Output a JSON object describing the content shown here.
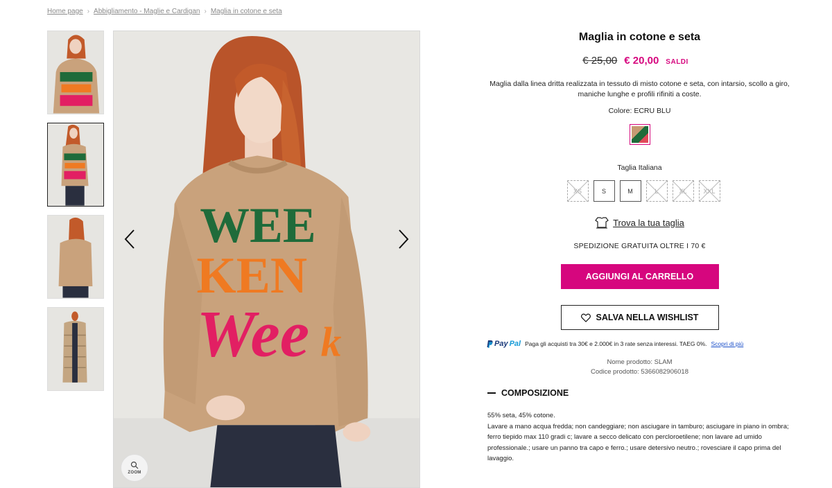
{
  "breadcrumb": {
    "items": [
      "Home page",
      "Abbigliamento - Maglie e Cardigan",
      "Maglia in cotone e seta"
    ]
  },
  "gallery": {
    "zoom_label": "ZOOM"
  },
  "product": {
    "title": "Maglia in cotone e seta",
    "old_price": "€ 25,00",
    "new_price": "€ 20,00",
    "sale_tag": "SALDI",
    "description": "Maglia dalla linea dritta realizzata in tessuto di misto cotone e seta, con intarsio, scollo a giro, maniche lunghe e profili rifiniti a coste.",
    "color_label": "Colore: ECRU BLU",
    "size_label": "Taglia Italiana",
    "sizes": [
      {
        "label": "XS",
        "available": false
      },
      {
        "label": "S",
        "available": true
      },
      {
        "label": "M",
        "available": true
      },
      {
        "label": "L",
        "available": false
      },
      {
        "label": "XL",
        "available": false
      },
      {
        "label": "XXL",
        "available": false
      }
    ],
    "find_size": "Trova la tua taglia",
    "shipping": "SPEDIZIONE GRATUITA OLTRE I 70 €",
    "add_to_cart": "AGGIUNGI AL CARRELLO",
    "wishlist": "SALVA NELLA WISHLIST",
    "paypal": {
      "pay": "Pay",
      "pal": "Pal",
      "text": "Paga gli acquisti tra 30€ e 2.000€ in 3 rate senza interessi. TAEG 0%.",
      "link": "Scopri di più"
    },
    "product_name": "Nome prodotto: SLAM",
    "product_code": "Codice prodotto:  5366082906018",
    "composition_title": "COMPOSIZIONE",
    "composition_material": "55% seta, 45% cotone.",
    "composition_care": "Lavare a mano acqua fredda; non candeggiare; non asciugare in tamburo; asciugare in piano in ombra; ferro tiepido max 110 gradi c; lavare a secco delicato con percloroetilene; non lavare ad umido professionale.; usare un panno tra capo e ferro.; usare detersivo neutro.; rovesciare il capo prima del lavaggio."
  },
  "colors": {
    "accent": "#d6067e",
    "sweater": "#c9a27c",
    "hair": "#c25a2a",
    "green": "#1f6b3a",
    "orange": "#ef7a22",
    "pink": "#e21f63"
  }
}
